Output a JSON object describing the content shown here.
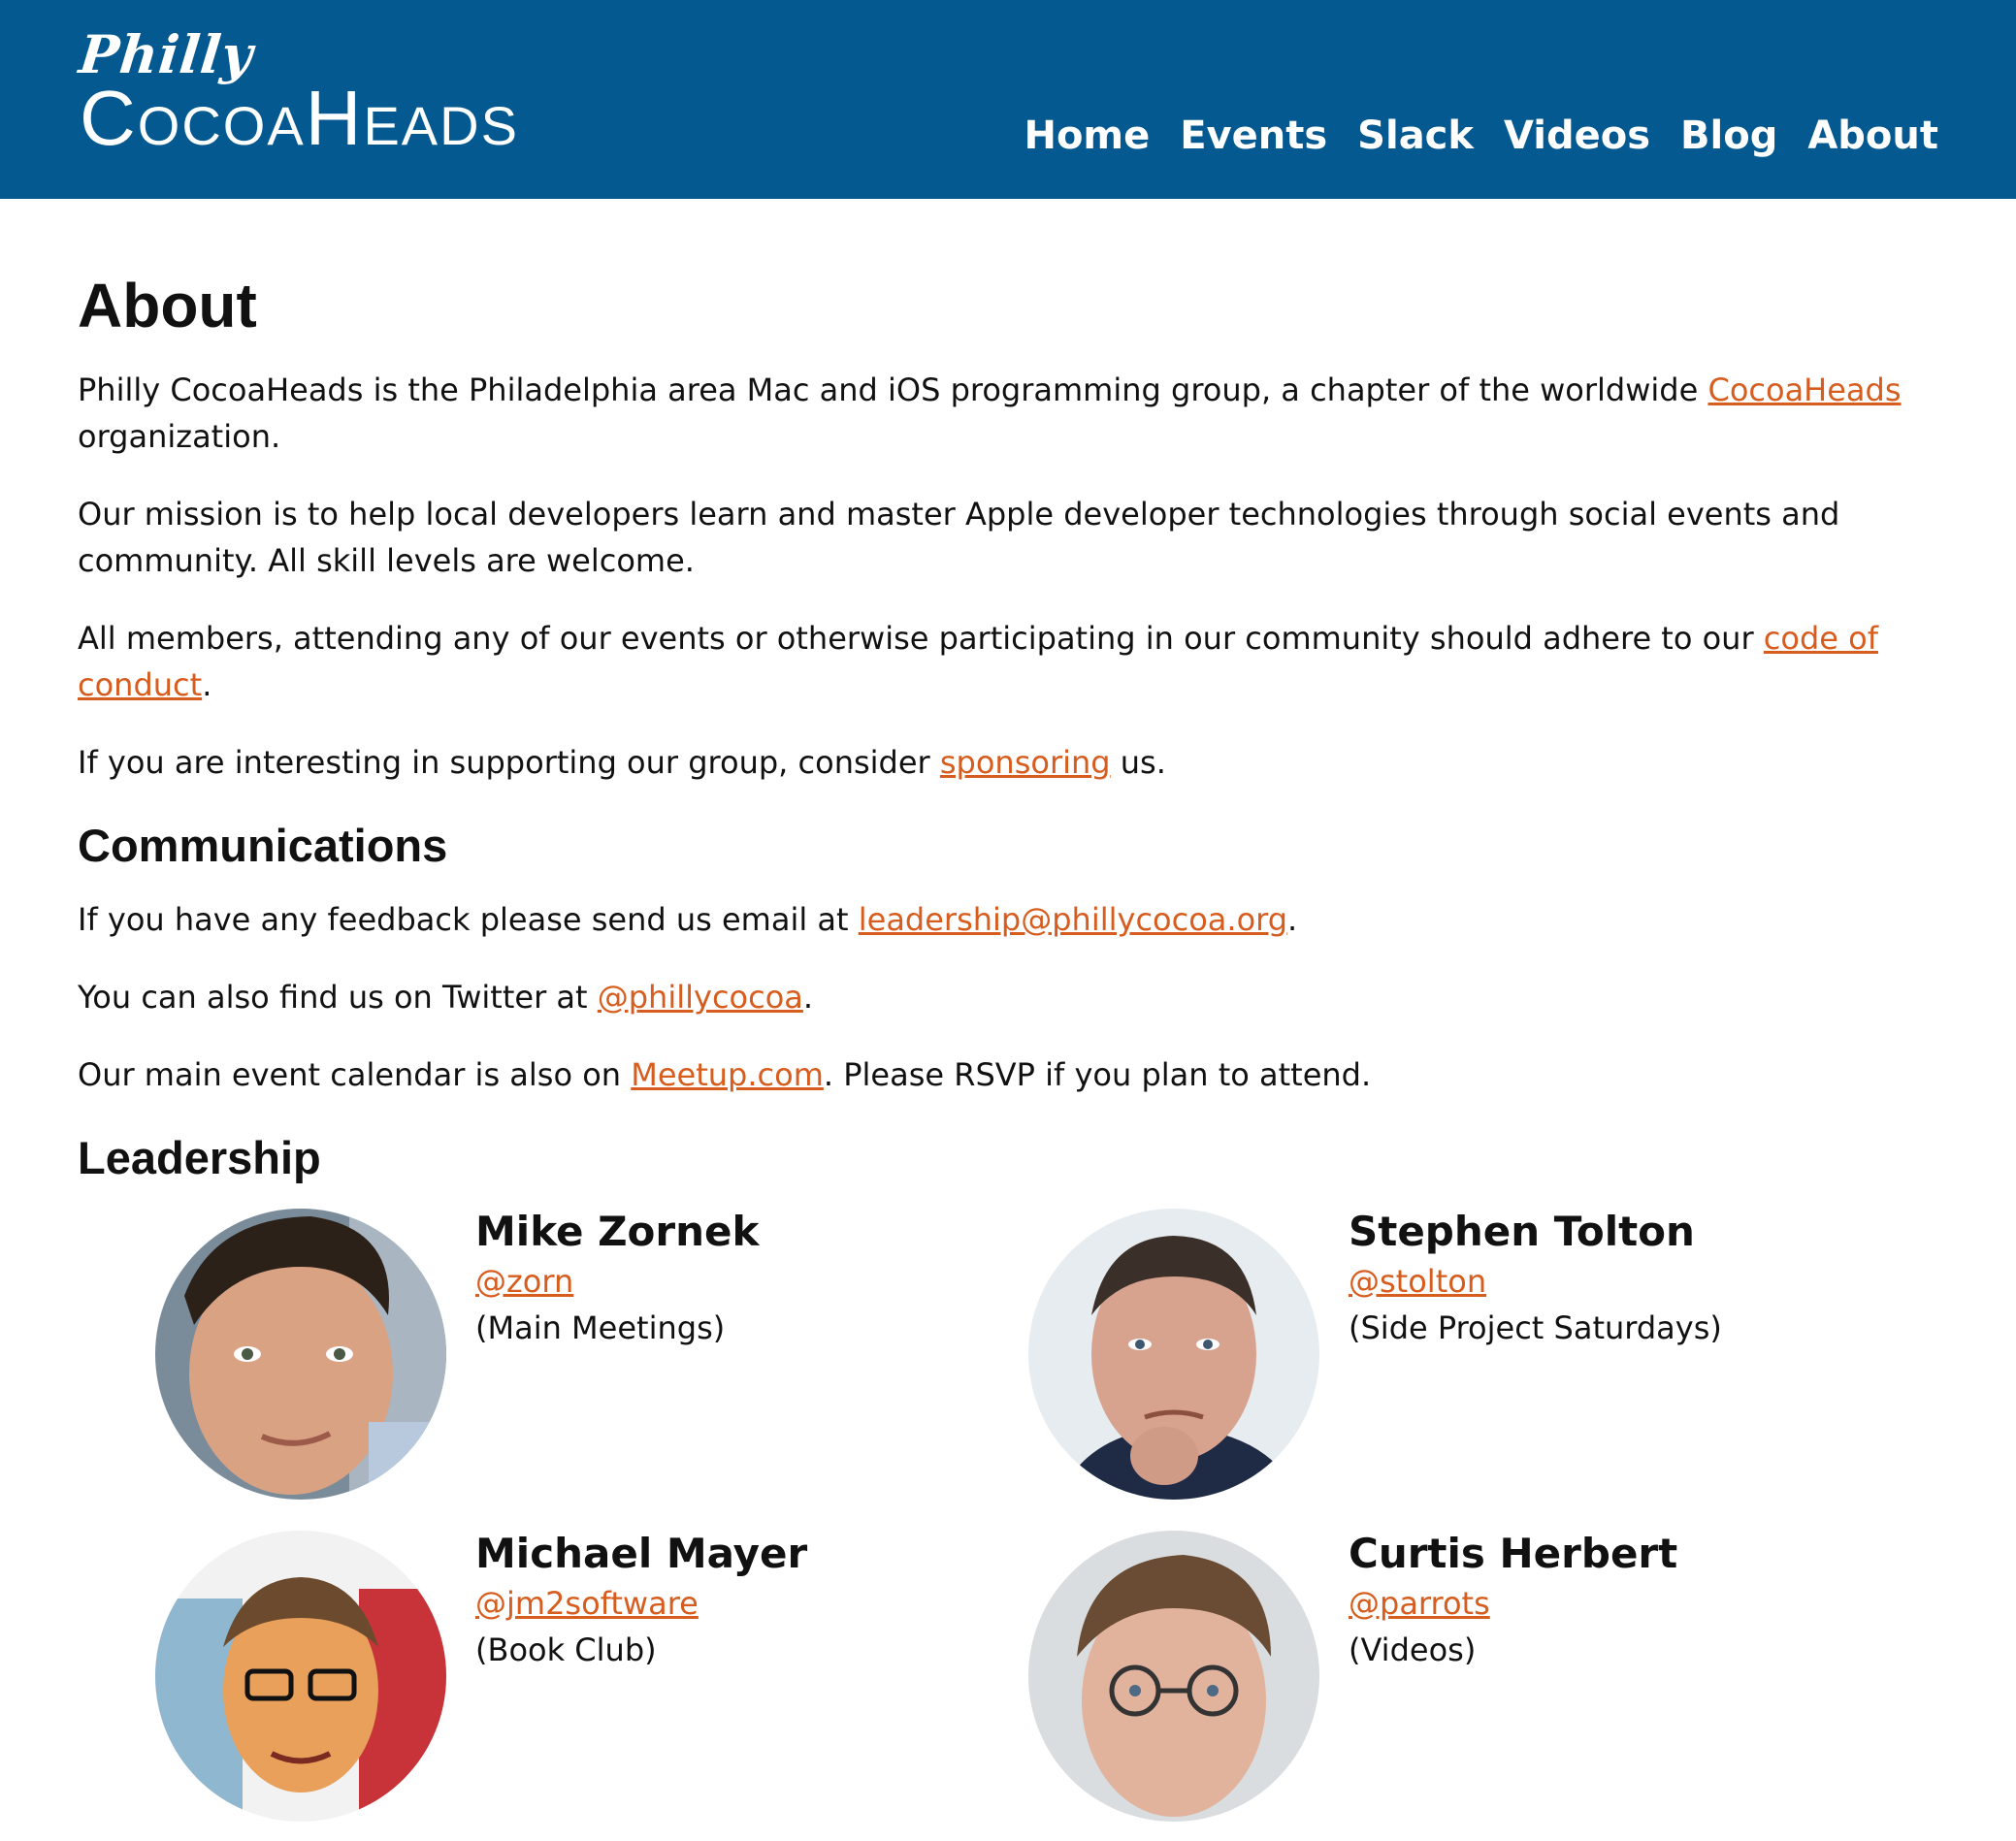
{
  "header": {
    "logo_script": "Philly",
    "logo_caps": "CocoaHeads",
    "nav": [
      "Home",
      "Events",
      "Slack",
      "Videos",
      "Blog",
      "About"
    ],
    "background_color": "#045991"
  },
  "main": {
    "title": "About",
    "intro": {
      "pre": "Philly CocoaHeads is the Philadelphia area Mac and iOS programming group, a chapter of the worldwide ",
      "link": "CocoaHeads",
      "post": " organization."
    },
    "mission": "Our mission is to help local developers learn and master Apple developer technologies through social events and community. All skill levels are welcome.",
    "conduct": {
      "pre": "All members, attending any of our events or otherwise participating in our community should adhere to our ",
      "link": "code of conduct",
      "post": "."
    },
    "sponsor": {
      "pre": "If you are interesting in supporting our group, consider ",
      "link": "sponsoring",
      "post": " us."
    },
    "communications": {
      "heading": "Communications",
      "feedback": {
        "pre": "If you have any feedback please send us email at ",
        "link": "leadership@phillycocoa.org",
        "post": "."
      },
      "twitter": {
        "pre": "You can also find us on Twitter at ",
        "link": "@phillycocoa",
        "post": "."
      },
      "meetup": {
        "pre": "Our main event calendar is also on ",
        "link": "Meetup.com",
        "post": ". Please RSVP if you plan to attend."
      }
    },
    "leadership": {
      "heading": "Leadership",
      "members": [
        {
          "name": "Mike Zornek",
          "handle": "@zorn",
          "role": "(Main Meetings)"
        },
        {
          "name": "Stephen Tolton",
          "handle": "@stolton",
          "role": "(Side Project Saturdays)"
        },
        {
          "name": "Michael Mayer",
          "handle": "@jm2software",
          "role": "(Book Club)"
        },
        {
          "name": "Curtis Herbert",
          "handle": "@parrots",
          "role": "(Videos)"
        }
      ]
    },
    "link_color": "#d75d1f"
  }
}
